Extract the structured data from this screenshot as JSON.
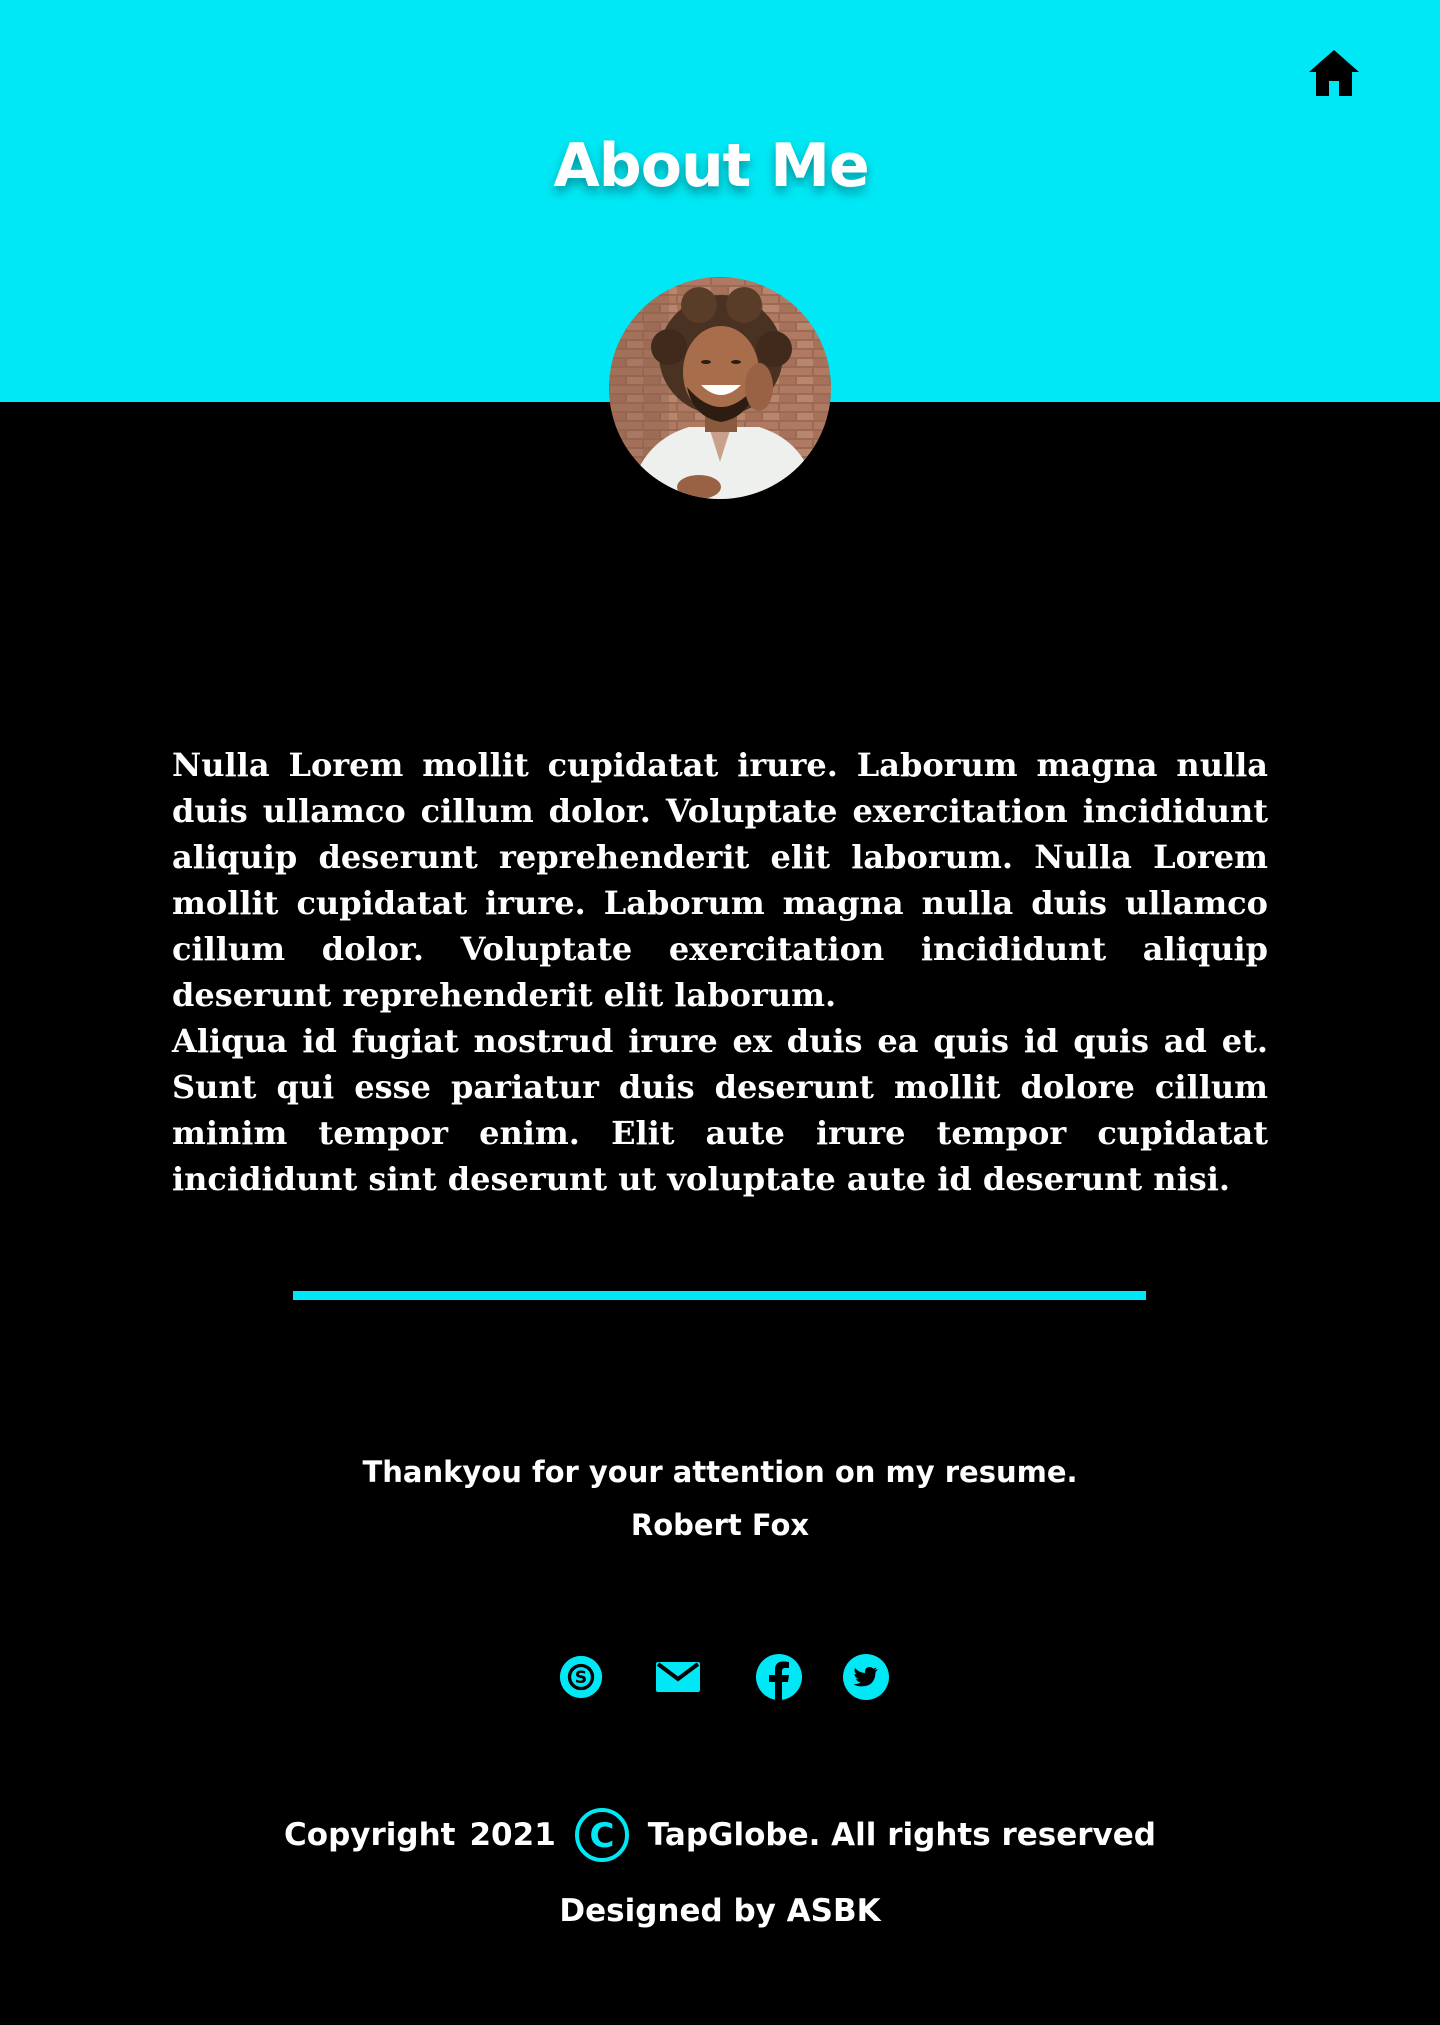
{
  "colors": {
    "accent": "#00E8F5",
    "background": "#000000",
    "text": "#FFFFFF"
  },
  "header": {
    "title": "About Me",
    "home_icon": "home-icon"
  },
  "profile": {
    "avatar": "profile-photo"
  },
  "bio": {
    "paragraphs": [
      "Nulla Lorem mollit cupidatat irure. Laborum magna nulla duis ullamco cillum dolor. Voluptate exercitation incididunt aliquip deserunt reprehenderit elit laborum. Nulla Lorem mollit cupidatat irure. Laborum magna nulla duis ullamco cillum dolor. Voluptate exercitation incididunt aliquip deserunt reprehenderit elit laborum.",
      "Aliqua id fugiat nostrud irure ex duis ea quis id quis ad et. Sunt qui esse pariatur duis deserunt mollit dolore cillum minim tempor enim. Elit aute irure tempor cupidatat incididunt sint deserunt ut voluptate aute id deserunt nisi."
    ]
  },
  "closing": {
    "thanks": "Thankyou for your attention on my resume.",
    "name": "Robert Fox"
  },
  "socials": [
    {
      "icon": "skype-icon"
    },
    {
      "icon": "mail-icon"
    },
    {
      "icon": "facebook-icon"
    },
    {
      "icon": "twitter-icon"
    }
  ],
  "footer": {
    "copyright_label": "Copyright",
    "year": "2021",
    "copyright_icon": "copyright-icon",
    "company_text": "TapGlobe. All rights reserved",
    "designed_by": "Designed by ASBK"
  }
}
